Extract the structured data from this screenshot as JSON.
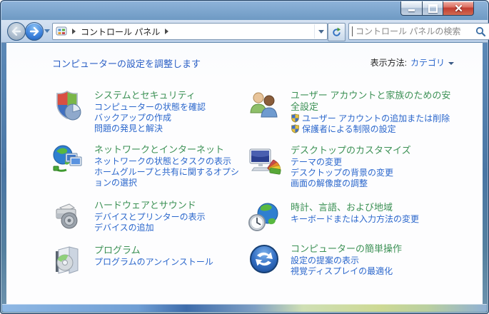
{
  "window": {
    "controls": [
      {
        "name": "minimize-button"
      },
      {
        "name": "maximize-button"
      },
      {
        "name": "close-button"
      }
    ]
  },
  "navbar": {
    "back_icon": "back-arrow-icon",
    "forward_icon": "forward-arrow-icon",
    "breadcrumb": {
      "root_icon": "control-panel-icon",
      "root": "コントロール パネル"
    },
    "refresh_icon": "refresh-icon",
    "search": {
      "placeholder": "コントロール パネルの検索",
      "icon": "search-icon"
    }
  },
  "header": {
    "title": "コンピューターの設定を調整します",
    "view_by_label": "表示方法:",
    "view_by_value": "カテゴリ"
  },
  "colors": {
    "category_title_green": "#3c9155",
    "link_blue": "#2b67cc",
    "header_blue": "#2b5fc5",
    "close_button_red": "#c23e32"
  },
  "categories": {
    "left": [
      {
        "icon": "system-security-icon",
        "title": "システムとセキュリティ",
        "links": [
          {
            "label": "コンピューターの状態を確認"
          },
          {
            "label": "バックアップの作成"
          },
          {
            "label": "問題の発見と解決"
          }
        ]
      },
      {
        "icon": "network-internet-icon",
        "title": "ネットワークとインターネット",
        "links": [
          {
            "label": "ネットワークの状態とタスクの表示"
          },
          {
            "label": "ホームグループと共有に関するオプションの選択"
          }
        ]
      },
      {
        "icon": "hardware-sound-icon",
        "title": "ハードウェアとサウンド",
        "links": [
          {
            "label": "デバイスとプリンターの表示"
          },
          {
            "label": "デバイスの追加"
          }
        ]
      },
      {
        "icon": "programs-icon",
        "title": "プログラム",
        "links": [
          {
            "label": "プログラムのアンインストール"
          }
        ]
      }
    ],
    "right": [
      {
        "icon": "user-accounts-icon",
        "title": "ユーザー アカウントと家族のための安全設定",
        "links": [
          {
            "label": "ユーザー アカウントの追加または削除",
            "shield": true
          },
          {
            "label": "保護者による制限の設定",
            "shield": true
          }
        ]
      },
      {
        "icon": "appearance-icon",
        "title": "デスクトップのカスタマイズ",
        "links": [
          {
            "label": "テーマの変更"
          },
          {
            "label": "デスクトップの背景の変更"
          },
          {
            "label": "画面の解像度の調整"
          }
        ]
      },
      {
        "icon": "clock-region-icon",
        "title": "時計、言語、および地域",
        "links": [
          {
            "label": "キーボードまたは入力方法の変更"
          }
        ]
      },
      {
        "icon": "ease-access-icon",
        "title": "コンピューターの簡単操作",
        "links": [
          {
            "label": "設定の提案の表示"
          },
          {
            "label": "視覚ディスプレイの最適化"
          }
        ]
      }
    ]
  }
}
